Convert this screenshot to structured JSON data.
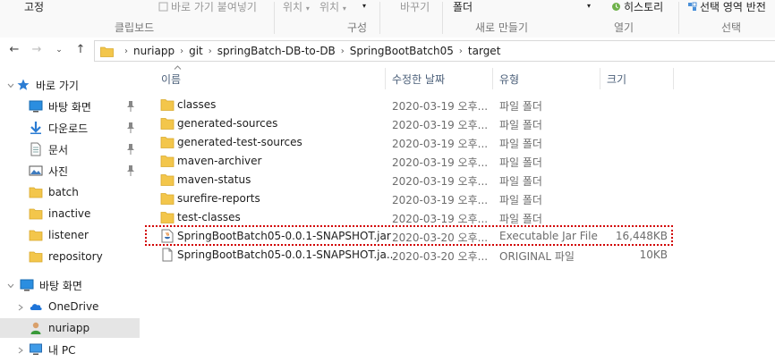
{
  "ribbon": {
    "pin_label": "고정",
    "clipboard_partial": "바로 가기 붙여넣기",
    "clipboard_group": "클립보드",
    "location_label_1": "위치",
    "location_label_2": "위치",
    "organize_group": "구성",
    "rename_label": "바꾸기",
    "folder_label": "폴더",
    "new_group": "새로 만들기",
    "history_label": "히스토리",
    "open_group": "열기",
    "select_label": "선택 영역 반전",
    "select_group": "선택"
  },
  "address": {
    "crumbs": [
      "nuriapp",
      "git",
      "springBatch-DB-to-DB",
      "SpringBootBatch05",
      "target"
    ]
  },
  "nav": {
    "quick_access": "바로 가기",
    "items": [
      {
        "label": "바탕 화면",
        "pinned": true
      },
      {
        "label": "다운로드",
        "pinned": true
      },
      {
        "label": "문서",
        "pinned": true
      },
      {
        "label": "사진",
        "pinned": true
      },
      {
        "label": "batch"
      },
      {
        "label": "inactive"
      },
      {
        "label": "listener"
      },
      {
        "label": "repository"
      }
    ],
    "desktop": "바탕 화면",
    "onedrive": "OneDrive",
    "user": "nuriapp",
    "pc": "내 PC"
  },
  "columns": {
    "name": "이름",
    "modified": "수정한 날짜",
    "type": "유형",
    "size": "크기"
  },
  "files": [
    {
      "name": "classes",
      "modified": "2020-03-19 오후...",
      "type": "파일 폴더",
      "size": "",
      "icon": "folder-icon"
    },
    {
      "name": "generated-sources",
      "modified": "2020-03-19 오후...",
      "type": "파일 폴더",
      "size": "",
      "icon": "folder-icon"
    },
    {
      "name": "generated-test-sources",
      "modified": "2020-03-19 오후...",
      "type": "파일 폴더",
      "size": "",
      "icon": "folder-icon"
    },
    {
      "name": "maven-archiver",
      "modified": "2020-03-19 오후...",
      "type": "파일 폴더",
      "size": "",
      "icon": "folder-icon"
    },
    {
      "name": "maven-status",
      "modified": "2020-03-19 오후...",
      "type": "파일 폴더",
      "size": "",
      "icon": "folder-icon"
    },
    {
      "name": "surefire-reports",
      "modified": "2020-03-19 오후...",
      "type": "파일 폴더",
      "size": "",
      "icon": "folder-icon"
    },
    {
      "name": "test-classes",
      "modified": "2020-03-19 오후...",
      "type": "파일 폴더",
      "size": "",
      "icon": "folder-icon"
    },
    {
      "name": "SpringBootBatch05-0.0.1-SNAPSHOT.jar",
      "modified": "2020-03-20 오후...",
      "type": "Executable Jar File",
      "size": "16,448KB",
      "icon": "java-jar-icon"
    },
    {
      "name": "SpringBootBatch05-0.0.1-SNAPSHOT.ja...",
      "modified": "2020-03-20 오후...",
      "type": "ORIGINAL 파일",
      "size": "10KB",
      "icon": "blank-file-icon"
    }
  ],
  "colors": {
    "folder": "#f3c64b",
    "selection": "#cce8ff",
    "highlight": "#d20000"
  }
}
